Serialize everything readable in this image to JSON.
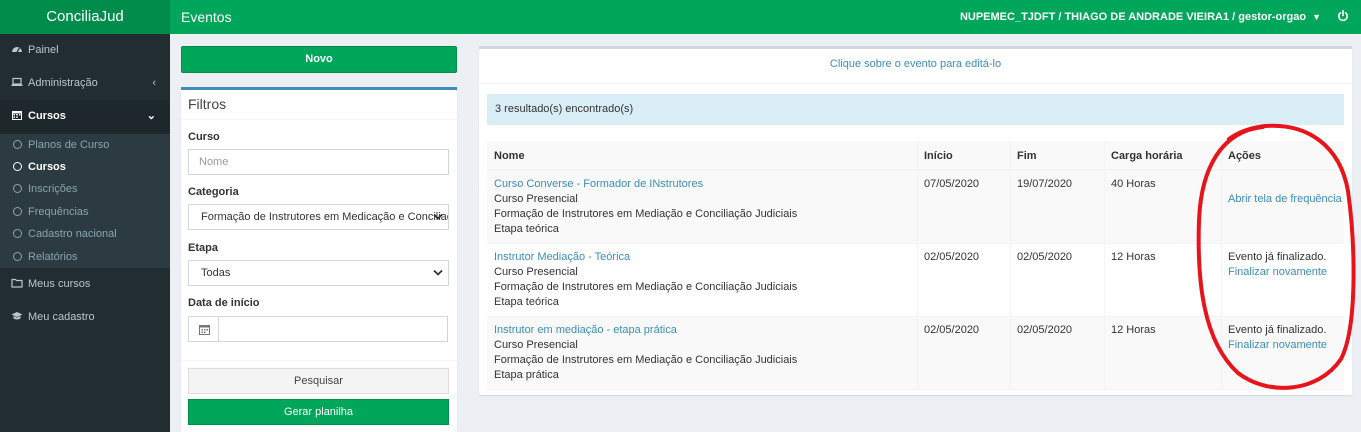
{
  "header": {
    "brand": "ConciliaJud",
    "title": "Eventos",
    "user": "NUPEMEC_TJDFT / THIAGO DE ANDRADE VIEIRA1 / gestor-orgao"
  },
  "sidebar": {
    "items": [
      {
        "label": "Painel",
        "icon": "dashboard-icon"
      },
      {
        "label": "Administração",
        "icon": "laptop-icon"
      },
      {
        "label": "Cursos",
        "icon": "calendar-icon"
      },
      {
        "label": "Meus cursos",
        "icon": "folder-icon"
      },
      {
        "label": "Meu cadastro",
        "icon": "graduation-cap-icon"
      }
    ],
    "submenu": [
      {
        "label": "Planos de Curso"
      },
      {
        "label": "Cursos"
      },
      {
        "label": "Inscrições"
      },
      {
        "label": "Frequências"
      },
      {
        "label": "Cadastro nacional"
      },
      {
        "label": "Relatórios"
      }
    ]
  },
  "actions": {
    "new_button": "Novo",
    "search_button": "Pesquisar",
    "spreadsheet_button": "Gerar planilha"
  },
  "filters": {
    "title": "Filtros",
    "course_label": "Curso",
    "course_placeholder": "Nome",
    "category_label": "Categoria",
    "category_value": "Formação de Instrutores em Medicação e Conciliação Judiciais",
    "stage_label": "Etapa",
    "stage_value": "Todas",
    "start_date_label": "Data de início",
    "start_date_value": ""
  },
  "results": {
    "hint": "Clique sobre o evento para editá-lo",
    "count_text": "3 resultado(s) encontrado(s)",
    "columns": [
      "Nome",
      "Início",
      "Fim",
      "Carga horária",
      "Ações"
    ],
    "rows": [
      {
        "name": "Curso Converse - Formador de INstrutores",
        "type": "Curso Presencial",
        "category": "Formação de Instrutores em Mediação e Conciliação Judiciais",
        "stage": "Etapa teórica",
        "start": "07/05/2020",
        "end": "19/07/2020",
        "hours": "40 Horas",
        "status": "",
        "action": "Abrir tela de frequência"
      },
      {
        "name": "Instrutor Mediação - Teórica",
        "type": "Curso Presencial",
        "category": "Formação de Instrutores em Mediação e Conciliação Judiciais",
        "stage": "Etapa teórica",
        "start": "02/05/2020",
        "end": "02/05/2020",
        "hours": "12 Horas",
        "status": "Evento já finalizado.",
        "action": "Finalizar novamente"
      },
      {
        "name": "Instrutor em mediação - etapa prática",
        "type": "Curso Presencial",
        "category": "Formação de Instrutores em Mediação e Conciliação Judiciais",
        "stage": "Etapa prática",
        "start": "02/05/2020",
        "end": "02/05/2020",
        "hours": "12 Horas",
        "status": "Evento já finalizado.",
        "action": "Finalizar novamente"
      }
    ]
  },
  "colors": {
    "brand_green": "#00a65a",
    "sidebar_dark": "#222d32",
    "link_blue": "#3c8dbc",
    "annotation_red": "#e8141c"
  }
}
